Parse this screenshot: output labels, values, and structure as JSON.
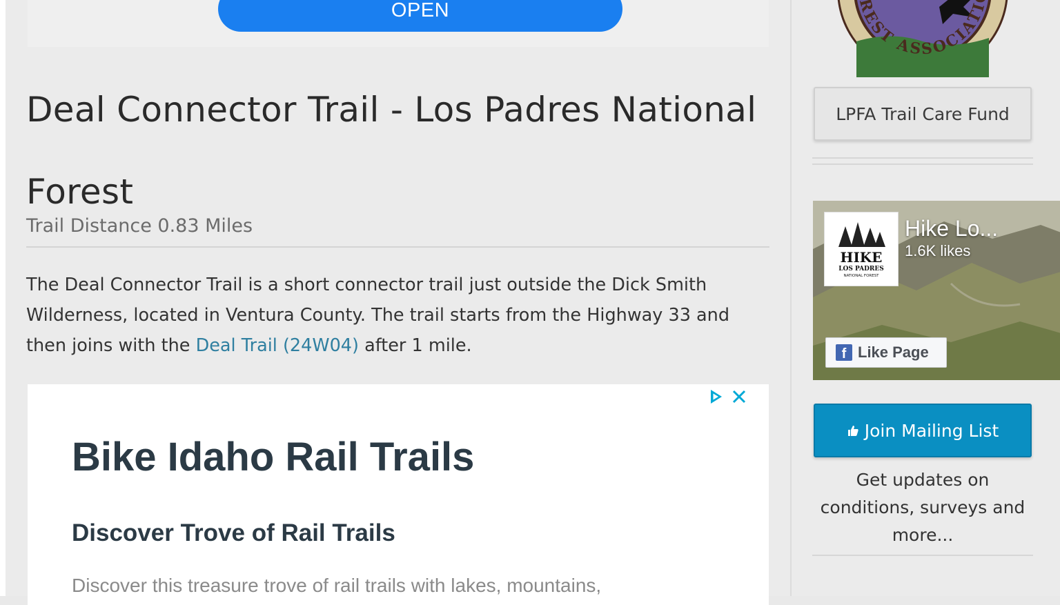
{
  "top_ad": {
    "open_label": "OPEN"
  },
  "article": {
    "title": "Deal Connector Trail - Los Padres National Forest",
    "distance": "Trail Distance 0.83 Miles",
    "description_before": "The Deal Connector Trail is a short connector trail just outside the Dick Smith Wilderness, located in Ventura County. The trail starts from the Highway 33 and then joins with the ",
    "link_text": "Deal Trail (24W04)",
    "description_after": " after 1 mile."
  },
  "ad": {
    "headline": "Bike Idaho Rail Trails",
    "subhead": "Discover Trove of Rail Trails",
    "body": "Discover this treasure trove of rail trails with lakes, mountains,"
  },
  "sidebar": {
    "logo_text": "FOREST ASSOCIATION",
    "trail_fund_label": "LPFA Trail Care Fund",
    "facebook": {
      "page_name": "Hike Lo...",
      "likes": "1.6K likes",
      "like_button": "Like Page",
      "thumb_text_1": "HIKE",
      "thumb_text_2": "LOS PADRES",
      "thumb_text_3": "NATIONAL FOREST"
    },
    "mailing_label": "Join Mailing List",
    "mailing_caption": "Get updates on conditions, surveys and more..."
  }
}
